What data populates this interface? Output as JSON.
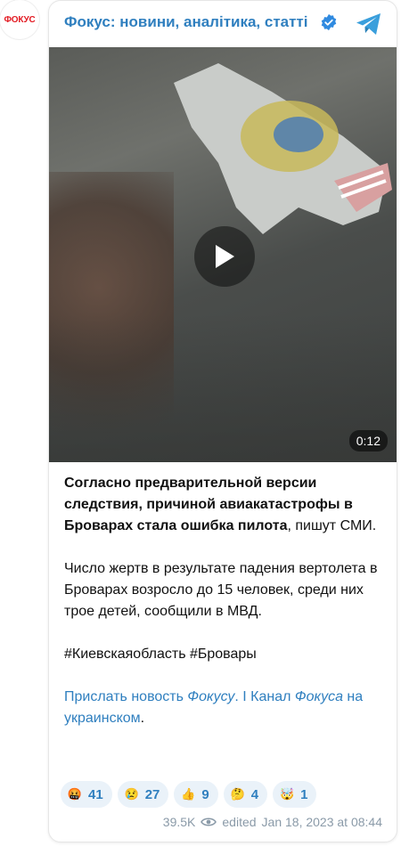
{
  "avatar": {
    "text": "ФОКУС",
    "icon": "focus-logo"
  },
  "header": {
    "channel_name": "Фокус: новини, аналітика, статті",
    "verified_icon": "verified-badge-icon",
    "telegram_icon": "telegram-icon"
  },
  "video": {
    "duration": "0:12",
    "play_icon": "play-icon"
  },
  "message": {
    "p1_bold": "Согласно предварительной версии следствия, причиной авиакатастрофы в Броварах стала ошибка пилота",
    "p1_rest": ", пишут СМИ.",
    "p2": "Число жертв в результате падения вертолета в Броварах возросло до 15 человек, среди них трое детей, сообщили в МВД.",
    "p3": "#Киевскаяобласть #Бровары",
    "link1": "Прислать новость ",
    "link1_italic": "Фокусу",
    "link_sep": ". I Канал ",
    "link2_italic": "Фокуса",
    "link2_rest": " на украинском",
    "link_end": "."
  },
  "reactions": [
    {
      "emoji": "🤬",
      "count": "41",
      "icon": "angry-face-icon"
    },
    {
      "emoji": "😢",
      "count": "27",
      "icon": "crying-face-icon"
    },
    {
      "emoji": "👍",
      "count": "9",
      "icon": "thumbs-up-icon"
    },
    {
      "emoji": "🤔",
      "count": "4",
      "icon": "thinking-face-icon"
    },
    {
      "emoji": "🤯",
      "count": "1",
      "icon": "exploding-head-icon"
    }
  ],
  "footer": {
    "views": "39.5K",
    "eye_icon": "eye-icon",
    "edited": "edited",
    "timestamp": "Jan 18, 2023 at 08:44"
  },
  "colors": {
    "link": "#2f7fbf",
    "brand_red": "#e31b23",
    "reaction_bg": "#eaf2f9",
    "meta_gray": "#8a9aa8"
  }
}
